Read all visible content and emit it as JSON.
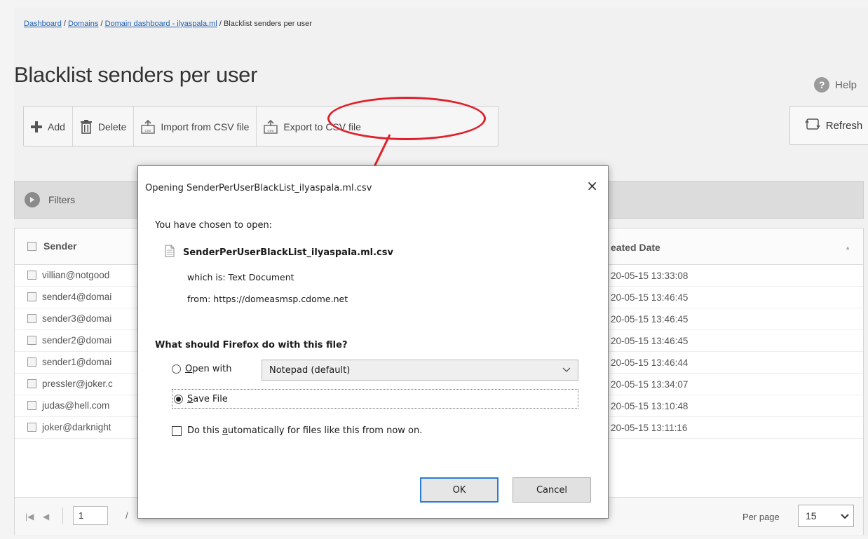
{
  "breadcrumb": {
    "items": [
      "Dashboard",
      "Domains",
      "Domain dashboard - ilyaspala.ml"
    ],
    "current": "Blacklist senders per user",
    "separator": " / "
  },
  "page": {
    "title": "Blacklist senders per user",
    "help_label": "Help",
    "help_icon": "?"
  },
  "toolbar": {
    "add_label": "Add",
    "delete_label": "Delete",
    "import_label": "Import from CSV file",
    "export_label": "Export to CSV file",
    "refresh_label": "Refresh"
  },
  "filters": {
    "label": "Filters"
  },
  "table": {
    "columns": {
      "sender": "Sender",
      "created": "eated Date"
    },
    "rows": [
      {
        "sender": "villian@notgood",
        "date": "20-05-15 13:33:08"
      },
      {
        "sender": "sender4@domai",
        "date": "20-05-15 13:46:45"
      },
      {
        "sender": "sender3@domai",
        "date": "20-05-15 13:46:45"
      },
      {
        "sender": "sender2@domai",
        "date": "20-05-15 13:46:45"
      },
      {
        "sender": "sender1@domai",
        "date": "20-05-15 13:46:44"
      },
      {
        "sender": "pressler@joker.c",
        "date": "20-05-15 13:34:07"
      },
      {
        "sender": "judas@hell.com",
        "date": "20-05-15 13:10:48"
      },
      {
        "sender": "joker@darknight",
        "date": "20-05-15 13:11:16"
      }
    ]
  },
  "pager": {
    "page": "1",
    "of_separator": "/",
    "per_page_label": "Per page",
    "per_page_value": "15"
  },
  "dialog": {
    "title": "Opening SenderPerUserBlackList_ilyaspala.ml.csv",
    "close": "×",
    "chosen_label": "You have chosen to open:",
    "file_name": "SenderPerUserBlackList_ilyaspala.ml.csv",
    "which_is": "which is:  Text Document",
    "from": "from:  https://domeasmsp.cdome.net",
    "question": "What should Firefox do with this file?",
    "open_with_prefix": "",
    "open_with_key": "O",
    "open_with_rest": "pen with",
    "open_with_app": "Notepad (default)",
    "save_key": "S",
    "save_rest": "ave File",
    "auto_prefix": "Do this ",
    "auto_key": "a",
    "auto_rest": "utomatically for files like this from now on.",
    "ok_label": "OK",
    "cancel_label": "Cancel",
    "selected_option": "save"
  },
  "colors": {
    "highlight": "#e0202a",
    "link": "#1e5fb3",
    "focus": "#2a7bd4"
  }
}
